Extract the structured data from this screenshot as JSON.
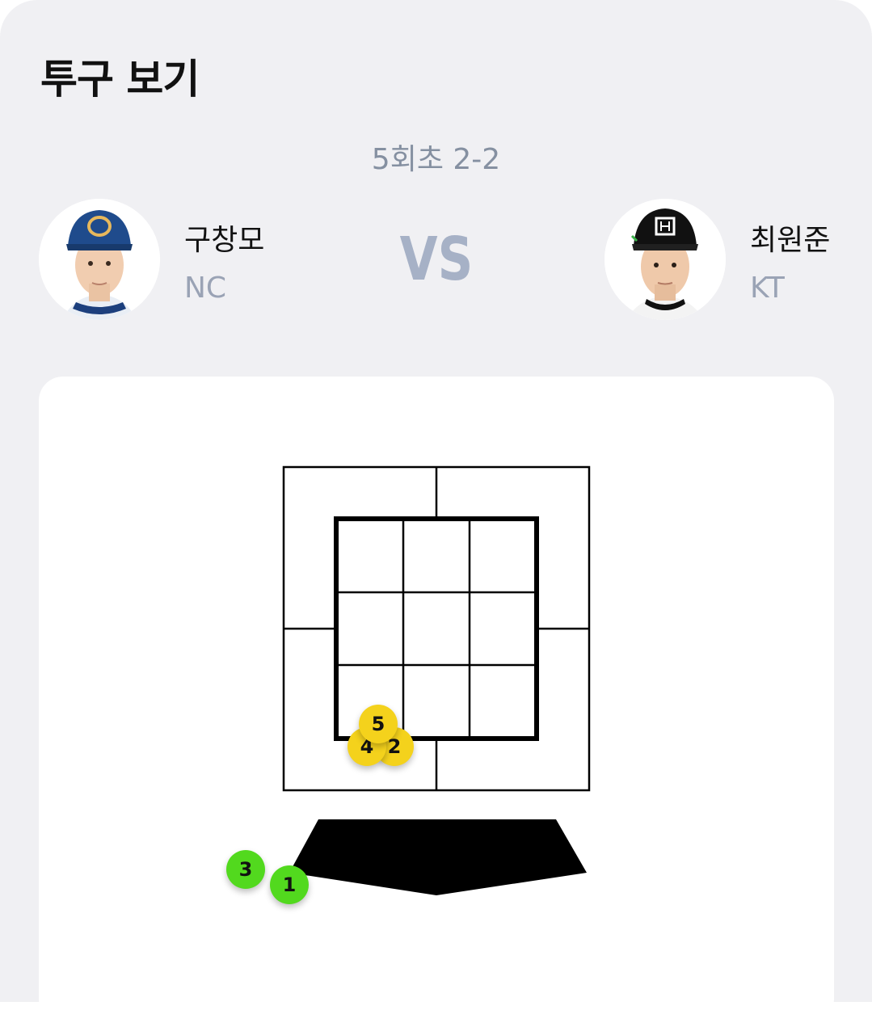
{
  "header": {
    "title": "투구 보기"
  },
  "game": {
    "inning_score": "5회초 2-2",
    "vs_label": "VS"
  },
  "pitcher": {
    "name": "구창모",
    "team": "NC",
    "avatar_icon": "player-photo-nc"
  },
  "batter": {
    "name": "최원준",
    "team": "KT",
    "avatar_icon": "player-photo-kt"
  },
  "colors": {
    "strike": "#f4d21c",
    "ball": "#52d91e",
    "accent": "#a6b1c6"
  },
  "pitches": [
    {
      "number": "1",
      "result": "ball"
    },
    {
      "number": "2",
      "result": "strike"
    },
    {
      "number": "3",
      "result": "ball"
    },
    {
      "number": "4",
      "result": "strike"
    },
    {
      "number": "5",
      "result": "strike"
    }
  ]
}
